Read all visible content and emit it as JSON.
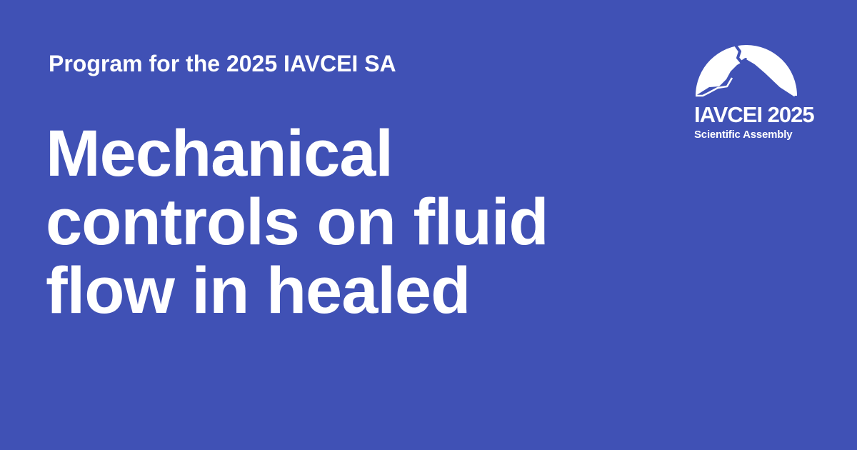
{
  "header": {
    "subtitle": "Program for the 2025 IAVCEI SA"
  },
  "title": {
    "lines": [
      "Mechanical",
      "controls on fluid",
      "flow in healed"
    ]
  },
  "logo": {
    "title": "IAVCEI 2025",
    "subtitle": "Scientific Assembly",
    "icon": "volcano-mountain-icon"
  },
  "colors": {
    "background": "#4051b5",
    "text": "#ffffff"
  }
}
